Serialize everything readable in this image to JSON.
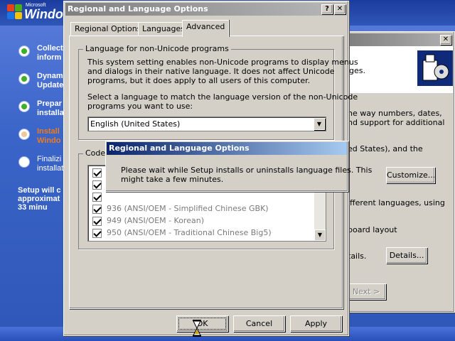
{
  "setup": {
    "logo_small": "Microsoft",
    "logo_text": "Windo",
    "steps": [
      {
        "text": "Collect\ninform",
        "state": "done"
      },
      {
        "text": "Dynam\nUpdate",
        "state": "done"
      },
      {
        "text": "Prepar\ninstalla",
        "state": "done"
      },
      {
        "text": "Install\nWindo",
        "state": "current"
      },
      {
        "text": "Finalizi\ninstallat",
        "state": "pending"
      }
    ],
    "time_remaining": "Setup will c\napproximat\n33 minu"
  },
  "background_dialog": {
    "close_label": "✕",
    "partial_lines": [
      "ges.",
      "he way numbers, dates,",
      "nd support for additional",
      "ed States), and the",
      "ifferent languages, using",
      "board layout",
      "tails."
    ],
    "customize_label": "Customize...",
    "details_label": "Details...",
    "next_label": "Next >"
  },
  "dialog": {
    "title": "Regional and Language Options",
    "help_btn": "?",
    "close_btn": "✕",
    "tabs": [
      "Regional Options",
      "Languages",
      "Advanced"
    ],
    "active_tab": "Advanced",
    "group_nonunicode_title": "Language for non-Unicode programs",
    "group_nonunicode_desc": "This system setting enables non-Unicode programs to display menus\nand dialogs in their native language. It does not affect Unicode\nprograms, but it does apply to all users of this computer.",
    "select_prompt": "Select a language to match the language version of the non-Unicode\nprograms you want to use:",
    "language_value": "English (United States)",
    "group_code_title": "Code",
    "code_pages": [
      {
        "label": "",
        "checked": true
      },
      {
        "label": "",
        "checked": true
      },
      {
        "label": "",
        "checked": true
      },
      {
        "label": "936   (ANSI/OEM - Simplified Chinese GBK)",
        "checked": true
      },
      {
        "label": "949   (ANSI/OEM - Korean)",
        "checked": true
      },
      {
        "label": "950   (ANSI/OEM - Traditional Chinese Big5)",
        "checked": true
      }
    ],
    "ok_label": "OK",
    "cancel_label": "Cancel",
    "apply_label": "Apply"
  },
  "wait_popup": {
    "title": "Regional and Language Options",
    "message": "Please wait while Setup installs or uninstalls language files. This\nmight take a few minutes."
  },
  "colors": {
    "setup_blue": "#3a64c8",
    "step_done": "#3fae2a",
    "step_current": "#f07a1c",
    "active_title": "#0a246a",
    "inactive_title": "#808080"
  }
}
